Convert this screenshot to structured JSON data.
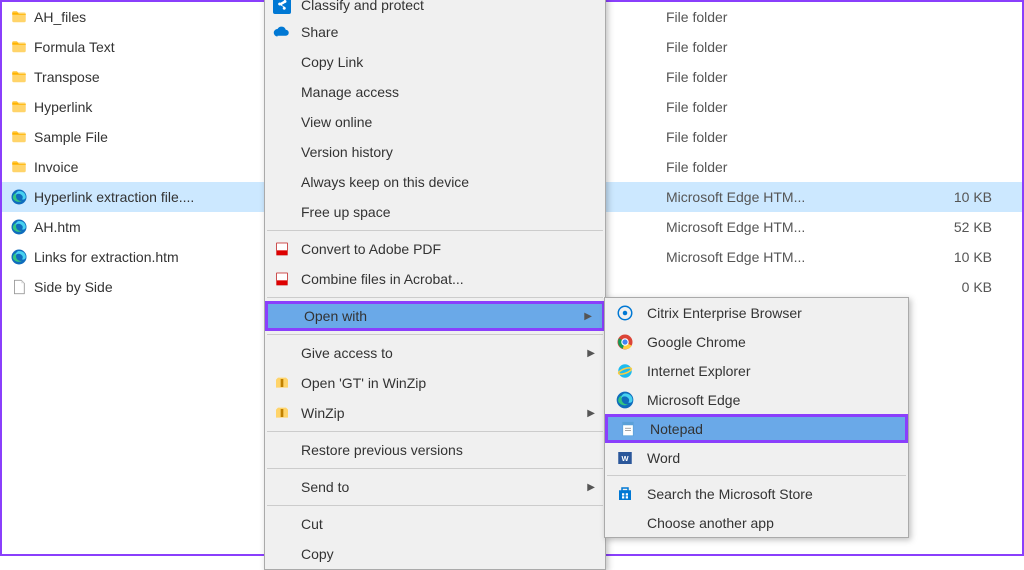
{
  "files": [
    {
      "name": "AH_files",
      "type": "File folder",
      "size": "",
      "icon": "folder",
      "status": "green"
    },
    {
      "name": "Formula Text",
      "type": "File folder",
      "size": "",
      "icon": "folder",
      "status": "green"
    },
    {
      "name": "Transpose",
      "type": "File folder",
      "size": "",
      "icon": "folder",
      "status": "green"
    },
    {
      "name": "Hyperlink",
      "type": "File folder",
      "size": "",
      "icon": "folder",
      "status": "green"
    },
    {
      "name": "Sample File",
      "type": "File folder",
      "size": "",
      "icon": "folder",
      "status": "cloud"
    },
    {
      "name": "Invoice",
      "type": "File folder",
      "size": "",
      "icon": "folder",
      "status": "cloud"
    },
    {
      "name": "Hyperlink extraction file....",
      "type": "Microsoft Edge HTM...",
      "size": "10 KB",
      "icon": "edge",
      "status": "sync",
      "selected": true
    },
    {
      "name": "AH.htm",
      "type": "Microsoft Edge HTM...",
      "size": "52 KB",
      "icon": "edge",
      "status": "green"
    },
    {
      "name": "Links for extraction.htm",
      "type": "Microsoft Edge HTM...",
      "size": "10 KB",
      "icon": "edge",
      "status": "green"
    },
    {
      "name": "Side by Side",
      "type": "",
      "size": "0 KB",
      "icon": "file",
      "status": ""
    }
  ],
  "context_menu": {
    "items": [
      {
        "label": "Classify and protect",
        "icon": "share-blue",
        "topcut": true
      },
      {
        "label": "Share",
        "icon": "cloud-blue"
      },
      {
        "label": "Copy Link"
      },
      {
        "label": "Manage access"
      },
      {
        "label": "View online"
      },
      {
        "label": "Version history"
      },
      {
        "label": "Always keep on this device"
      },
      {
        "label": "Free up space"
      },
      {
        "sep": true
      },
      {
        "label": "Convert to Adobe PDF",
        "icon": "pdf"
      },
      {
        "label": "Combine files in Acrobat...",
        "icon": "pdf"
      },
      {
        "sep": true
      },
      {
        "label": "Open with",
        "submenu": true,
        "highlight": true,
        "purple": true
      },
      {
        "sep": true
      },
      {
        "label": "Give access to",
        "submenu": true
      },
      {
        "label": "Open 'GT' in WinZip",
        "icon": "winzip"
      },
      {
        "label": "WinZip",
        "icon": "winzip",
        "submenu": true
      },
      {
        "sep": true
      },
      {
        "label": "Restore previous versions"
      },
      {
        "sep": true
      },
      {
        "label": "Send to",
        "submenu": true
      },
      {
        "sep": true
      },
      {
        "label": "Cut"
      },
      {
        "label": "Copy"
      }
    ]
  },
  "submenu": {
    "items": [
      {
        "label": "Citrix Enterprise Browser",
        "icon": "citrix"
      },
      {
        "label": "Google Chrome",
        "icon": "chrome"
      },
      {
        "label": "Internet Explorer",
        "icon": "ie"
      },
      {
        "label": "Microsoft Edge",
        "icon": "edge"
      },
      {
        "label": "Notepad",
        "icon": "notepad",
        "highlight": true,
        "purple": true
      },
      {
        "label": "Word",
        "icon": "word"
      },
      {
        "sep": true
      },
      {
        "label": "Search the Microsoft Store",
        "icon": "store"
      },
      {
        "label": "Choose another app"
      }
    ]
  }
}
